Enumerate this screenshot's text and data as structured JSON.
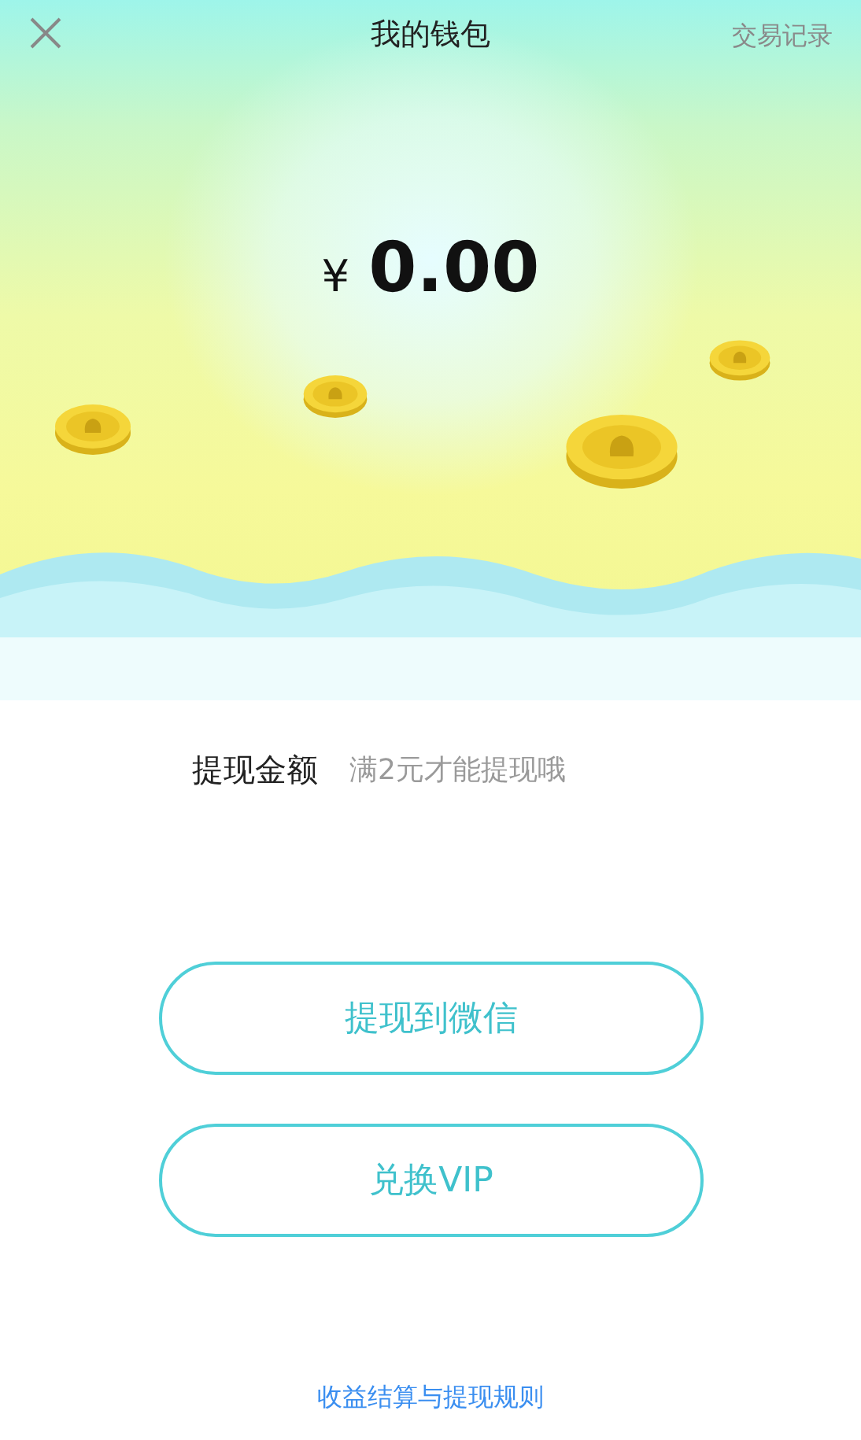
{
  "header": {
    "title": "我的钱包",
    "action": "交易记录"
  },
  "balance": {
    "currency": "¥",
    "amount": "0.00"
  },
  "withdraw": {
    "label": "提现金额",
    "placeholder": "满2元才能提现哦"
  },
  "buttons": [
    "提现到微信",
    "兑换VIP"
  ],
  "rules_link": "收益结算与提现规则"
}
